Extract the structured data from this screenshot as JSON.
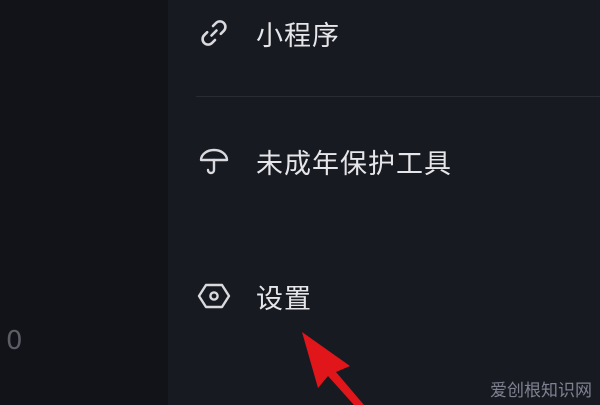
{
  "left_pane": {
    "value": "0"
  },
  "menu": {
    "items": [
      {
        "label": "小程序",
        "icon": "link-icon"
      },
      {
        "label": "未成年保护工具",
        "icon": "umbrella-icon"
      },
      {
        "label": "设置",
        "icon": "hexagon-icon"
      }
    ]
  },
  "watermark": "爱创根知识网",
  "colors": {
    "background": "#181a22",
    "text": "#e6e6ea",
    "icon": "#d9d9de",
    "arrow": "#e0161b"
  }
}
